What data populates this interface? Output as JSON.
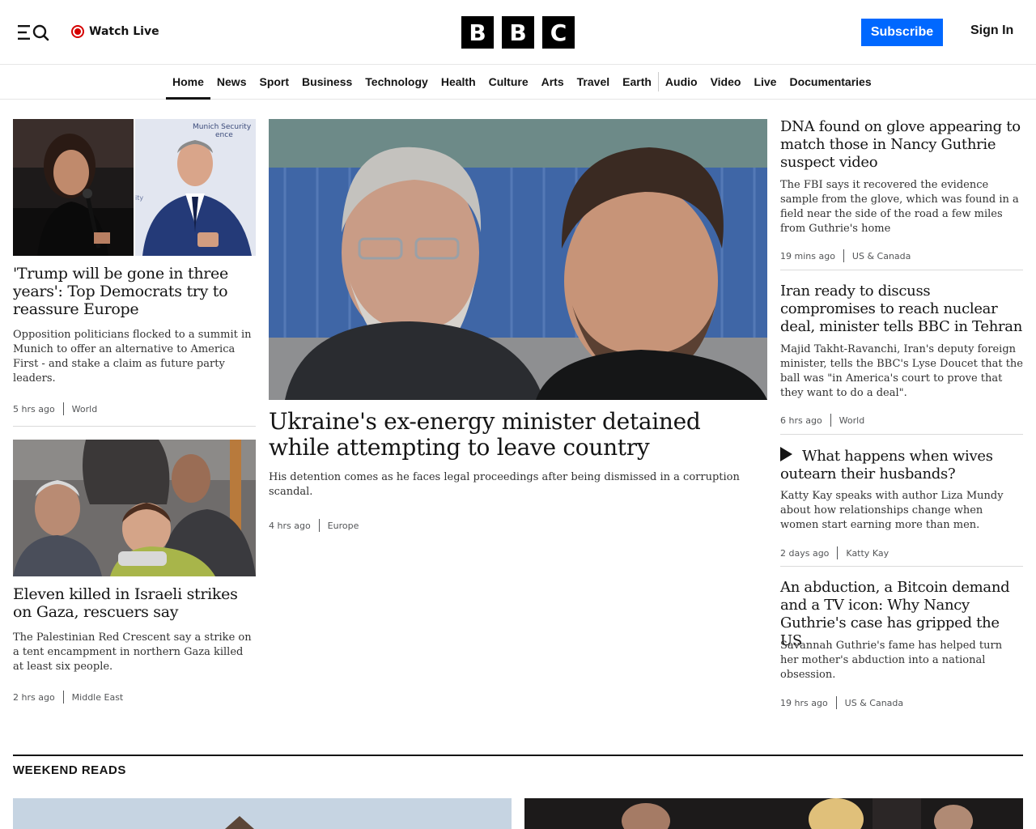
{
  "header": {
    "watch_live": "Watch Live",
    "logo_letters": [
      "B",
      "B",
      "C"
    ],
    "subscribe": "Subscribe",
    "sign_in": "Sign In"
  },
  "nav": {
    "items": [
      "Home",
      "News",
      "Sport",
      "Business",
      "Technology",
      "Health",
      "Culture",
      "Arts",
      "Travel",
      "Earth",
      "Audio",
      "Video",
      "Live",
      "Documentaries"
    ],
    "active": "Home"
  },
  "left": {
    "story1": {
      "headline": "'Trump will be gone in three years': Top Democrats try to reassure Europe",
      "summary": "Opposition politicians flocked to a summit in Munich to offer an alternative to America First - and stake a claim as future party leaders.",
      "time": "5 hrs ago",
      "section": "World",
      "image_sign_text": "Munich Security\nConference"
    },
    "story2": {
      "headline": "Eleven killed in Israeli strikes on Gaza, rescuers say",
      "summary": "The Palestinian Red Crescent say a strike on a tent encampment in northern Gaza killed at least six people.",
      "time": "2 hrs ago",
      "section": "Middle East"
    }
  },
  "lead": {
    "headline": "Ukraine's ex-energy minister detained while attempting to leave country",
    "summary": "His detention comes as he faces legal proceedings after being dismissed in a corruption scandal.",
    "time": "4 hrs ago",
    "section": "Europe"
  },
  "right": {
    "story1": {
      "headline": "DNA found on glove appearing to match those in Nancy Guthrie suspect video",
      "summary": "The FBI says it recovered the evidence sample from the glove, which was found in a field near the side of the road a few miles from Guthrie's home",
      "time": "19 mins ago",
      "section": "US & Canada"
    },
    "story2": {
      "headline": "Iran ready to discuss compromises to reach nuclear deal, minister tells BBC in Tehran",
      "summary": "Majid Takht-Ravanchi, Iran's deputy foreign minister, tells the BBC's Lyse Doucet that the ball was \"in America's court to prove that they want to do a deal\".",
      "time": "6 hrs ago",
      "section": "World"
    },
    "story3": {
      "headline": "What happens when wives outearn their husbands?",
      "summary": "Katty Kay speaks with author Liza Mundy about how relationships change when women start earning more than men.",
      "time": "2 days ago",
      "section": "Katty Kay"
    },
    "story4": {
      "headline": "An abduction, a Bitcoin demand and a TV icon: Why Nancy Guthrie's case has gripped the US",
      "summary": "Savannah Guthrie's fame has helped turn her mother's abduction into a national obsession.",
      "time": "19 hrs ago",
      "section": "US & Canada"
    }
  },
  "weekend_reads": {
    "title": "WEEKEND READS"
  }
}
